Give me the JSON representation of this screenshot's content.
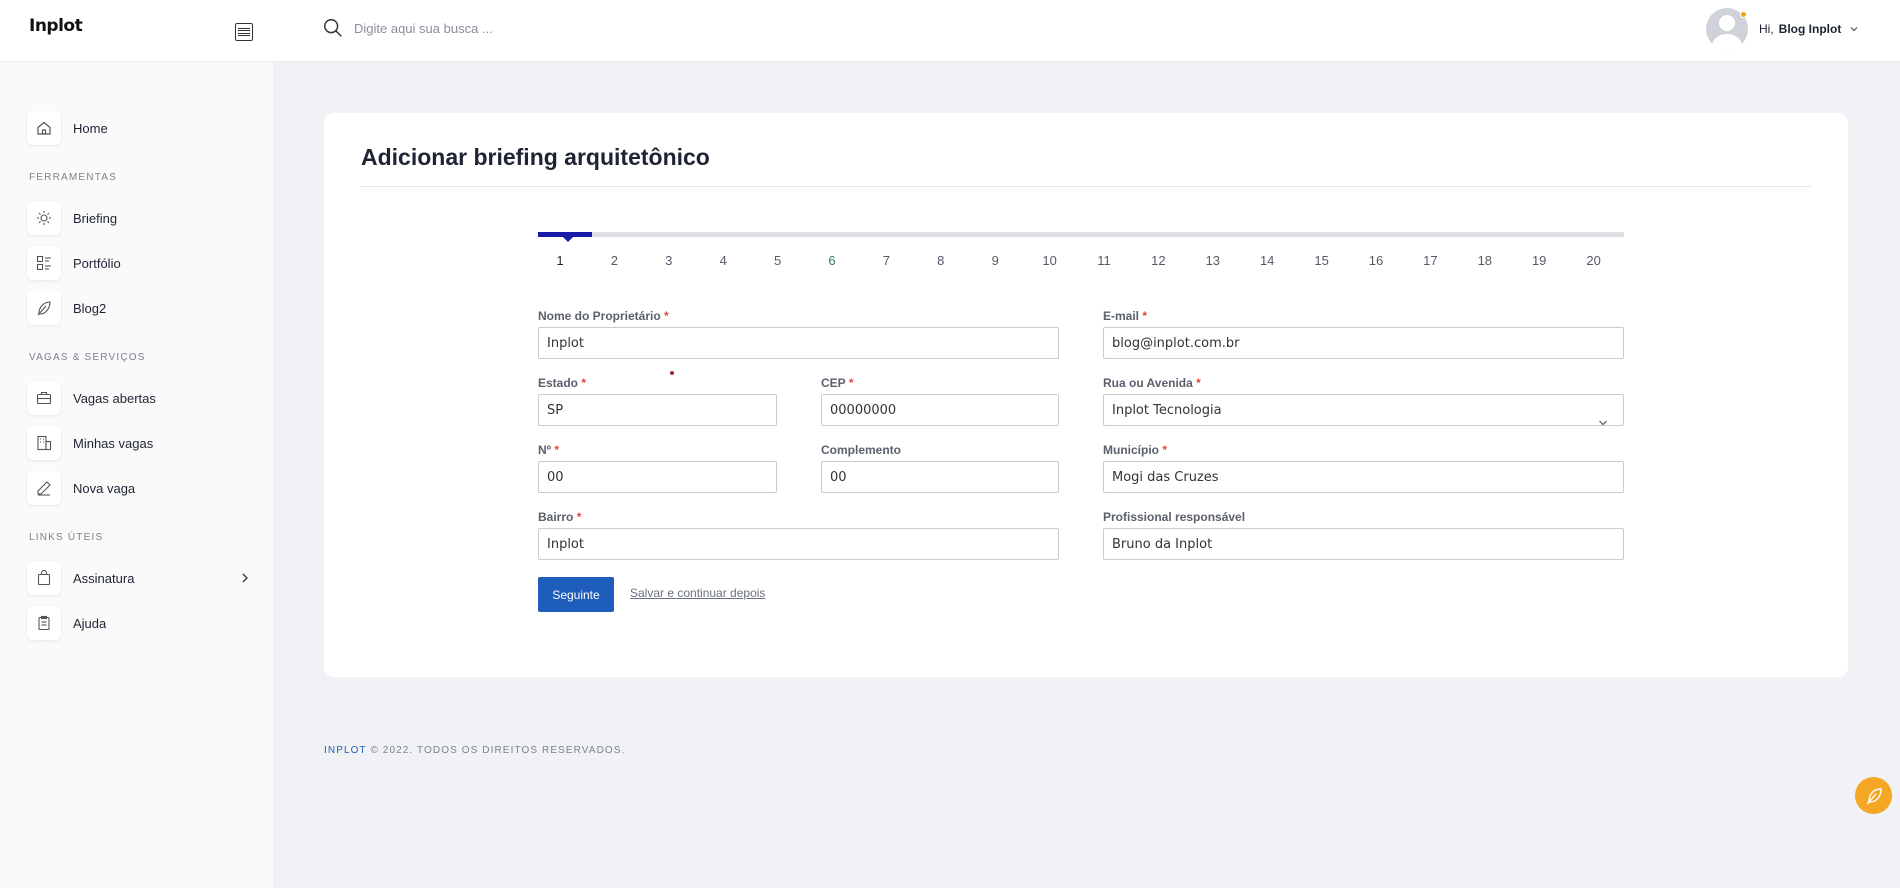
{
  "header": {
    "logo_text": "Inplot",
    "search_placeholder": "Digite aqui sua busca ...",
    "user_greeting": "Hi,",
    "user_name": "Blog Inplot"
  },
  "sidebar": {
    "home": "Home",
    "section_tools": "FERRAMENTAS",
    "tools": [
      "Briefing",
      "Portfólio",
      "Blog2"
    ],
    "section_jobs": "VAGAS & SERVIÇOS",
    "jobs": [
      "Vagas abertas",
      "Minhas vagas",
      "Nova vaga"
    ],
    "section_links": "LINKS ÚTEIS",
    "links": [
      "Assinatura",
      "Ajuda"
    ]
  },
  "page": {
    "title": "Adicionar briefing arquitetônico"
  },
  "stepper": {
    "steps": [
      "1",
      "2",
      "3",
      "4",
      "5",
      "6",
      "7",
      "8",
      "9",
      "10",
      "11",
      "12",
      "13",
      "14",
      "15",
      "16",
      "17",
      "18",
      "19",
      "20"
    ],
    "current": 1,
    "progress_fraction": 0.05
  },
  "form": {
    "owner": {
      "label": "Nome do Proprietário",
      "value": "Inplot"
    },
    "email": {
      "label": "E-mail",
      "value": "blog@inplot.com.br"
    },
    "estado": {
      "label": "Estado",
      "value": "SP"
    },
    "cep": {
      "label": "CEP",
      "value": "00000000"
    },
    "rua": {
      "label": "Rua ou Avenida",
      "value": "Inplot Tecnologia"
    },
    "numero": {
      "label": "Nº",
      "value": "00"
    },
    "complemento": {
      "label": "Complemento",
      "value": "00"
    },
    "municipio": {
      "label": "Município",
      "value": "Mogi das Cruzes"
    },
    "bairro": {
      "label": "Bairro",
      "value": "Inplot"
    },
    "profissional": {
      "label": "Profissional responsável",
      "value": "Bruno da Inplot"
    },
    "required_mark": "*"
  },
  "actions": {
    "next": "Seguinte",
    "save_later": "Salvar e continuar depois"
  },
  "footer": {
    "brand": "INPLOT",
    "text": "© 2022. TODOS OS DIREITOS RESERVADOS."
  },
  "colors": {
    "primary": "#1f5dbd",
    "stepper_fill": "#1a1aa8",
    "fab": "#f5a623",
    "required": "#e0473f"
  }
}
